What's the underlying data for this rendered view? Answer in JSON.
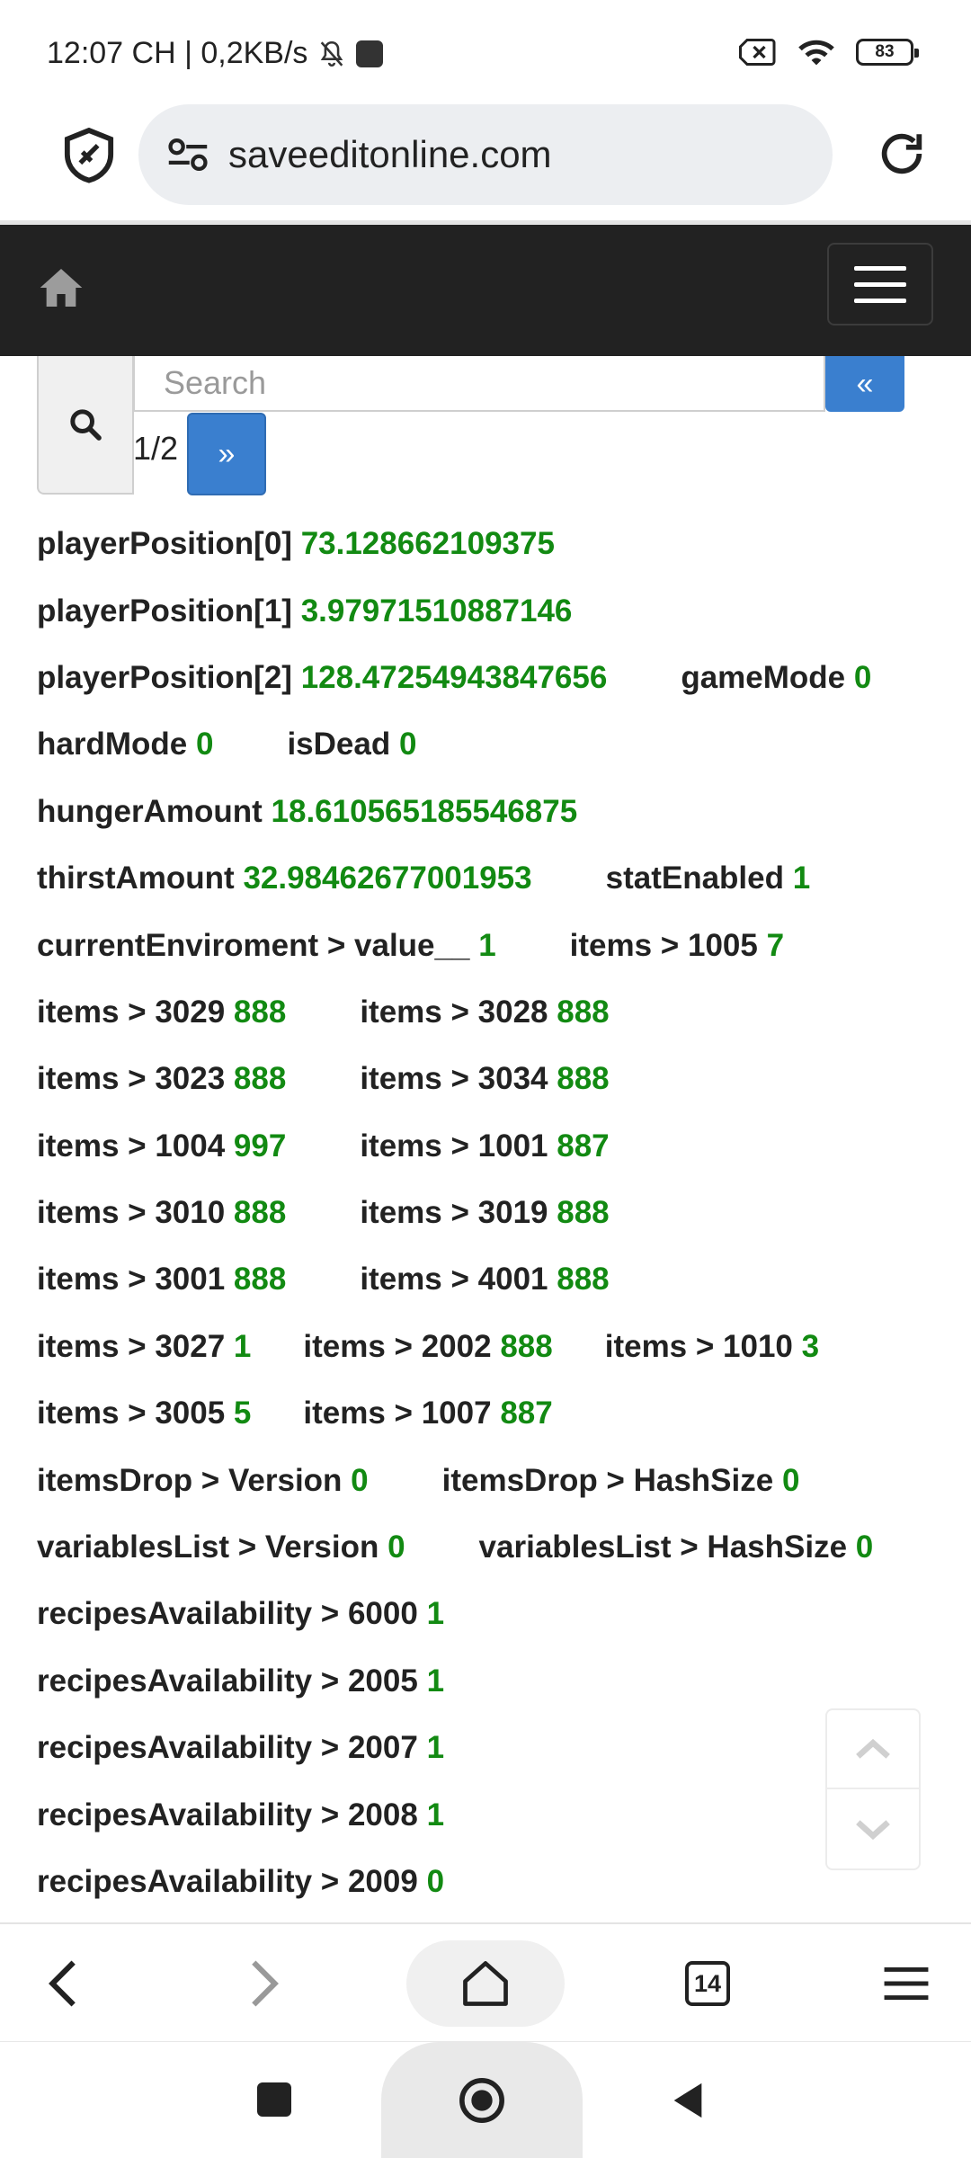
{
  "status_bar": {
    "time_info": "12:07 CH | 0,2KB/s",
    "battery": "83",
    "icons": [
      "bell-off-icon",
      "app-square-icon",
      "sim-x-icon",
      "wifi-icon",
      "battery-icon"
    ]
  },
  "browser": {
    "url": "saveeditonline.com",
    "tab_count": "14",
    "icons": [
      "shield-icon",
      "site-settings-icon",
      "reload-icon",
      "back-icon",
      "forward-icon",
      "home-icon",
      "tabs-icon",
      "menu-icon"
    ]
  },
  "navbar": {
    "icons": [
      "home-icon",
      "hamburger-menu-icon"
    ]
  },
  "search": {
    "placeholder": "Search",
    "prev_label": "«",
    "next_label": "»",
    "page": "1/2"
  },
  "rows": [
    [
      {
        "label": "playerPosition[0]",
        "value": "73.128662109375"
      }
    ],
    [
      {
        "label": "playerPosition[1]",
        "value": "3.97971510887146"
      }
    ],
    [
      {
        "label": "playerPosition[2]",
        "value": "128.47254943847656"
      },
      {
        "label": "gameMode",
        "value": "0"
      }
    ],
    [
      {
        "label": "hardMode",
        "value": "0"
      },
      {
        "label": "isDead",
        "value": "0"
      }
    ],
    [
      {
        "label": "hungerAmount",
        "value": "18.610565185546875"
      }
    ],
    [
      {
        "label": "thirstAmount",
        "value": "32.98462677001953"
      },
      {
        "label": "statEnabled",
        "value": "1"
      }
    ],
    [
      {
        "label": "currentEnviroment > value__",
        "value": "1"
      },
      {
        "label": "items > 1005",
        "value": "7"
      }
    ],
    [
      {
        "label": "items > 3029",
        "value": "888"
      },
      {
        "label": "items > 3028",
        "value": "888"
      }
    ],
    [
      {
        "label": "items > 3023",
        "value": "888"
      },
      {
        "label": "items > 3034",
        "value": "888"
      }
    ],
    [
      {
        "label": "items > 1004",
        "value": "997"
      },
      {
        "label": "items > 1001",
        "value": "887"
      }
    ],
    [
      {
        "label": "items > 3010",
        "value": "888"
      },
      {
        "label": "items > 3019",
        "value": "888"
      }
    ],
    [
      {
        "label": "items > 3001",
        "value": "888"
      },
      {
        "label": "items > 4001",
        "value": "888"
      }
    ],
    [
      {
        "label": "items > 3027",
        "value": "1"
      },
      {
        "label": "items > 2002",
        "value": "888"
      },
      {
        "label": "items > 1010",
        "value": "3"
      }
    ],
    [
      {
        "label": "items > 3005",
        "value": "5"
      },
      {
        "label": "items > 1007",
        "value": "887"
      }
    ],
    [
      {
        "label": "itemsDrop > Version",
        "value": "0"
      },
      {
        "label": "itemsDrop > HashSize",
        "value": "0"
      }
    ],
    [
      {
        "label": "variablesList > Version",
        "value": "0"
      },
      {
        "label": "variablesList > HashSize",
        "value": "0"
      }
    ],
    [
      {
        "label": "recipesAvailability > 6000",
        "value": "1"
      }
    ],
    [
      {
        "label": "recipesAvailability > 2005",
        "value": "1"
      }
    ],
    [
      {
        "label": "recipesAvailability > 2007",
        "value": "1"
      }
    ],
    [
      {
        "label": "recipesAvailability > 2008",
        "value": "1"
      }
    ],
    [
      {
        "label": "recipesAvailability > 2009",
        "value": "0"
      }
    ]
  ],
  "colors": {
    "navbar_bg": "#222222",
    "button_blue": "#3a7fcf",
    "value_green": "#128a12"
  }
}
